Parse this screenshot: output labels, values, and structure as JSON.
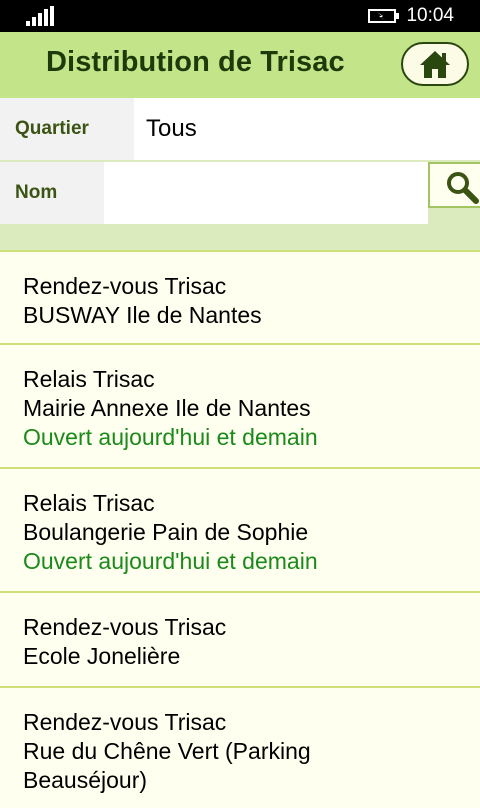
{
  "status_bar": {
    "time": "10:04",
    "signal_icon": "signal-strength-icon",
    "battery_icon": "battery-charging-icon"
  },
  "header": {
    "title": "Distribution de Trisac",
    "home_icon": "home-icon"
  },
  "filters": {
    "quartier_label": "Quartier",
    "quartier_value": "Tous",
    "nom_label": "Nom",
    "nom_value": "",
    "search_icon": "search-icon"
  },
  "locations": [
    {
      "type": "Rendez-vous Trisac",
      "place": "BUSWAY Ile de Nantes",
      "status": ""
    },
    {
      "type": "Relais Trisac",
      "place": "Mairie Annexe Ile de Nantes",
      "status": "Ouvert aujourd'hui et demain"
    },
    {
      "type": "Relais Trisac",
      "place": "Boulangerie Pain de Sophie",
      "status": "Ouvert aujourd'hui et demain"
    },
    {
      "type": "Rendez-vous Trisac",
      "place": "Ecole Jonelière",
      "status": ""
    },
    {
      "type": "Rendez-vous Trisac",
      "place_line1": "Rue du Chêne Vert (Parking",
      "place_line2": "Beauséjour)",
      "status": ""
    }
  ],
  "colors": {
    "header_bg": "#c4e48a",
    "accent_dark": "#2a4710",
    "status_green": "#1a8a1a",
    "list_bg": "#fffff0"
  }
}
